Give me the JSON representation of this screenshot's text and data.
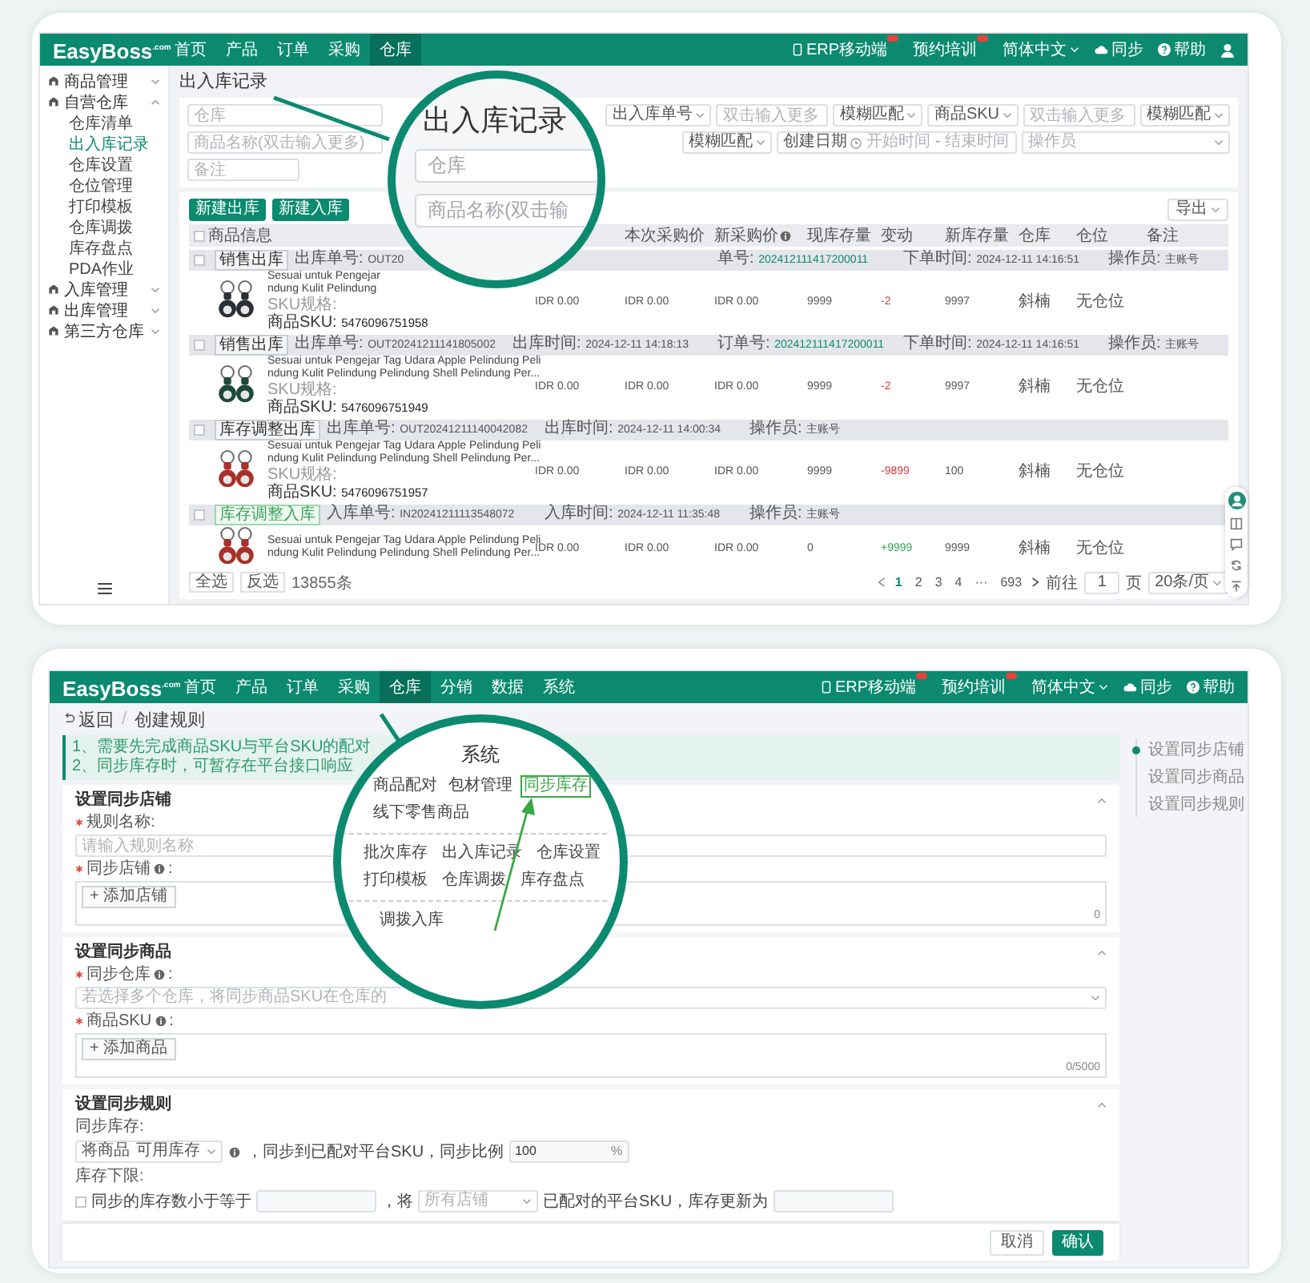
{
  "top_screen": {
    "header": {
      "logo": "EasyBoss",
      "logo_mark": ".com",
      "nav": [
        {
          "label": "首页",
          "selected": false
        },
        {
          "label": "产品",
          "selected": false
        },
        {
          "label": "订单",
          "selected": false
        },
        {
          "label": "采购",
          "selected": false
        },
        {
          "label": "仓库",
          "selected": true
        }
      ],
      "tools": [
        {
          "kind": "mobile",
          "label": "ERP移动端",
          "badge": true
        },
        {
          "kind": "training",
          "label": "预约培训",
          "badge": true
        },
        {
          "kind": "language",
          "label": "简体中文"
        },
        {
          "kind": "sync",
          "label": "同步"
        },
        {
          "kind": "help",
          "label": "帮助"
        },
        {
          "kind": "user"
        }
      ]
    },
    "sidebar": {
      "items": [
        {
          "label": "商品管理",
          "expanded": false
        },
        {
          "label": "自营仓库",
          "expanded": true,
          "children": [
            {
              "label": "仓库清单",
              "selected": false
            },
            {
              "label": "出入库记录",
              "selected": true
            },
            {
              "label": "仓库设置",
              "selected": false
            },
            {
              "label": "仓位管理",
              "selected": false
            },
            {
              "label": "打印模板",
              "selected": false
            },
            {
              "label": "仓库调拨",
              "selected": false
            },
            {
              "label": "库存盘点",
              "selected": false
            },
            {
              "label": "PDA作业",
              "selected": false
            }
          ]
        },
        {
          "label": "入库管理",
          "expanded": false
        },
        {
          "label": "出库管理",
          "expanded": false
        },
        {
          "label": "第三方仓库",
          "expanded": false
        }
      ]
    },
    "page_title": "出入库记录",
    "filters": [
      [
        {
          "kind": "field",
          "placeholder": "仓库"
        },
        {
          "kind": "select",
          "value": "出入库单号"
        },
        {
          "kind": "field",
          "placeholder": "双击输入更多"
        },
        {
          "kind": "select",
          "value": "模糊匹配"
        },
        {
          "kind": "select",
          "value": "商品SKU"
        },
        {
          "kind": "field",
          "placeholder": "双击输入更多"
        },
        {
          "kind": "select",
          "value": "模糊匹配"
        }
      ],
      [
        {
          "kind": "field",
          "placeholder": "商品名称(双击输入更多)"
        },
        {
          "kind": "select",
          "value": "模糊匹配"
        },
        {
          "kind": "date_range",
          "label": "创建日期",
          "start": "开始时间",
          "separator": "-",
          "end": "结束时间"
        },
        {
          "kind": "select",
          "placeholder": "操作员"
        }
      ],
      [
        {
          "kind": "field",
          "placeholder": "备注"
        }
      ]
    ],
    "actions": [
      "新建出库",
      "新建入库"
    ],
    "export": "导出",
    "table": {
      "header_checked": false,
      "columns": [
        {
          "label": "商品信息",
          "kind": "product"
        },
        {
          "label": "本次采购价"
        },
        {
          "label": "新采购价",
          "info": true
        },
        {
          "label": "现库存量"
        },
        {
          "label": "变动"
        },
        {
          "label": "新库存量"
        },
        {
          "label": "仓库"
        },
        {
          "label": "仓位"
        },
        {
          "label": "备注"
        }
      ],
      "records": [
        {
          "tag": "销售出库",
          "inbound": false,
          "checked": false,
          "fields": [
            {
              "kind": "number",
              "label": "出库单号: ",
              "value": "OUT20"
            },
            {
              "kind": "order",
              "label": "单号: ",
              "value": "202412111417200011"
            },
            {
              "kind": "time",
              "label": "下单时间: ",
              "value": "2024-12-11 14:16:51"
            },
            {
              "kind": "operator",
              "label": "操作员: ",
              "value": "主账号"
            }
          ],
          "product": {
            "name_lines": [
              "Sesuai untuk Pengejar",
              "ndung Kulit Pelindung"
            ],
            "spec_label": "SKU规格:",
            "sku_label": "商品SKU: ",
            "sku": "5476096751958"
          },
          "values": [
            "IDR 0.00",
            "IDR 0.00",
            "IDR 0.00",
            "9999"
          ],
          "change": {
            "text": "-2",
            "increase": false
          },
          "new_stock": "9997",
          "warehouse": "斜楠",
          "location": "无仓位"
        },
        {
          "tag": "销售出库",
          "inbound": false,
          "checked": false,
          "fields": [
            {
              "kind": "number",
              "label": "出库单号: ",
              "value": "OUT20241211141805002"
            },
            {
              "kind": "time",
              "label": "出库时间: ",
              "value": "2024-12-11 14:18:13"
            },
            {
              "kind": "order",
              "label": "订单号: ",
              "value": "202412111417200011"
            },
            {
              "kind": "time",
              "label": "下单时间: ",
              "value": "2024-12-11 14:16:51"
            },
            {
              "kind": "operator",
              "label": "操作员: ",
              "value": "主账号"
            }
          ],
          "product": {
            "name_lines": [
              "Sesuai untuk Pengejar Tag Udara Apple Pelindung Peli",
              "ndung Kulit Pelindung Pelindung Shell Pelindung Per..."
            ],
            "spec_label": "SKU规格:",
            "sku_label": "商品SKU: ",
            "sku": "5476096751949"
          },
          "values": [
            "IDR 0.00",
            "IDR 0.00",
            "IDR 0.00",
            "9999"
          ],
          "change": {
            "text": "-2",
            "increase": false
          },
          "new_stock": "9997",
          "warehouse": "斜楠",
          "location": "无仓位"
        },
        {
          "tag": "库存调整出库",
          "inbound": false,
          "checked": false,
          "fields": [
            {
              "kind": "number",
              "label": "出库单号: ",
              "value": "OUT20241211140042082"
            },
            {
              "kind": "time",
              "label": "出库时间: ",
              "value": "2024-12-11 14:00:34"
            },
            {
              "kind": "operator",
              "label": "操作员: ",
              "value": "主账号"
            }
          ],
          "product": {
            "name_lines": [
              "Sesuai untuk Pengejar Tag Udara Apple Pelindung Peli",
              "ndung Kulit Pelindung Pelindung Shell Pelindung Per..."
            ],
            "spec_label": "SKU规格:",
            "sku_label": "商品SKU: ",
            "sku": "5476096751957"
          },
          "values": [
            "IDR 0.00",
            "IDR 0.00",
            "IDR 0.00",
            "9999"
          ],
          "change": {
            "text": "-9899",
            "increase": false
          },
          "new_stock": "100",
          "warehouse": "斜楠",
          "location": "无仓位"
        },
        {
          "tag": "库存调整入库",
          "inbound": true,
          "checked": false,
          "fields": [
            {
              "kind": "number",
              "label": "入库单号: ",
              "value": "IN20241211113548072"
            },
            {
              "kind": "time",
              "label": "入库时间: ",
              "value": "2024-12-11 11:35:48"
            },
            {
              "kind": "operator",
              "label": "操作员: ",
              "value": "主账号"
            }
          ],
          "product": {
            "name_lines": [
              "Sesuai untuk Pengejar Tag Udara Apple Pelindung Peli",
              "ndung Kulit Pelindung Pelindung Shell Pelindung Per..."
            ]
          },
          "values": [
            "IDR 0.00",
            "IDR 0.00",
            "IDR 0.00",
            "0"
          ],
          "change": {
            "text": "+9999",
            "increase": true
          },
          "new_stock": "9999",
          "warehouse": "斜楠",
          "location": "无仓位"
        }
      ]
    },
    "footer": {
      "buttons": [
        "全选",
        "反选"
      ],
      "total": "13855条",
      "pages": [
        {
          "label": "1",
          "selected": true
        },
        {
          "label": "2",
          "selected": false
        },
        {
          "label": "3",
          "selected": false
        },
        {
          "label": "4",
          "selected": false
        },
        {
          "label": "···",
          "selected": false
        },
        {
          "label": "693",
          "selected": false
        }
      ],
      "goto_label": "前往",
      "goto_value": "1",
      "page_unit": "页",
      "page_size": "20条/页"
    },
    "magnifier": {
      "title": "出入库记录",
      "fields": [
        "仓库",
        "商品名称(双击输"
      ]
    }
  },
  "bottom_screen": {
    "header": {
      "logo": "EasyBoss",
      "logo_mark": ".com",
      "nav": [
        {
          "label": "首页",
          "selected": false
        },
        {
          "label": "产品",
          "selected": false
        },
        {
          "label": "订单",
          "selected": false
        },
        {
          "label": "采购",
          "selected": false
        },
        {
          "label": "仓库",
          "selected": true
        },
        {
          "label": "分销",
          "selected": false
        },
        {
          "label": "数据",
          "selected": false
        },
        {
          "label": "系统",
          "selected": false
        }
      ],
      "tools": [
        {
          "kind": "mobile",
          "label": "ERP移动端",
          "badge": true
        },
        {
          "kind": "training",
          "label": "预约培训",
          "badge": true
        },
        {
          "kind": "language",
          "label": "简体中文"
        },
        {
          "kind": "sync",
          "label": "同步"
        },
        {
          "kind": "help",
          "label": "帮助"
        }
      ]
    },
    "breadcrumb": {
      "back": "返回",
      "separator": "/",
      "current": "创建规则"
    },
    "notice": [
      "1、需要先完成商品SKU与平台SKU的配对",
      "2、同步库存时，可暂存在平台接口响应"
    ],
    "sections": [
      {
        "title": "设置同步店铺",
        "expanded": true,
        "fields": [
          {
            "kind": "input",
            "required": true,
            "label": "规则名称:",
            "placeholder": "请输入规则名称"
          },
          {
            "kind": "picker",
            "required": true,
            "label": "同步店铺",
            "info": true,
            "suffix": ":",
            "button": "+ 添加店铺",
            "counter": "0"
          }
        ]
      },
      {
        "title": "设置同步商品",
        "expanded": true,
        "fields": [
          {
            "kind": "select",
            "required": true,
            "label": "同步仓库",
            "info": true,
            "suffix": ":",
            "placeholder": "若选择多个仓库，将同步商品SKU在仓库的"
          },
          {
            "kind": "picker",
            "required": true,
            "label": "商品SKU",
            "info": true,
            "suffix": ":",
            "button": "+ 添加商品",
            "counter": "0/5000"
          }
        ]
      },
      {
        "title": "设置同步规则",
        "expanded": true,
        "fields": [
          {
            "kind": "caption",
            "label": "同步库存:"
          },
          {
            "kind": "row",
            "parts": [
              {
                "kind": "select",
                "prefix": "将商品",
                "value": "可用库存"
              },
              {
                "kind": "info"
              },
              {
                "kind": "text",
                "text": "，同步到已配对平台SKU，同步比例"
              },
              {
                "kind": "input",
                "value": "100",
                "suffix": "%"
              }
            ]
          },
          {
            "kind": "caption",
            "label": "库存下限:"
          },
          {
            "kind": "row",
            "parts": [
              {
                "kind": "checkbox",
                "label": "同步的库存数小于等于",
                "checked": false
              },
              {
                "kind": "input"
              },
              {
                "kind": "text",
                "text": "，将"
              },
              {
                "kind": "select",
                "placeholder": "所有店铺"
              },
              {
                "kind": "text",
                "text": "已配对的平台SKU，库存更新为"
              },
              {
                "kind": "input"
              }
            ]
          }
        ]
      }
    ],
    "anchors": [
      {
        "label": "设置同步店铺",
        "selected": true
      },
      {
        "label": "设置同步商品",
        "selected": false
      },
      {
        "label": "设置同步规则",
        "selected": false
      }
    ],
    "buttons": [
      {
        "label": "取消",
        "kind": "secondary"
      },
      {
        "label": "确认",
        "kind": "primary"
      }
    ],
    "magnifier": {
      "header": "系统",
      "groups": [
        {
          "items": [
            {
              "label": "商品配对",
              "selected": false
            },
            {
              "label": "包材管理",
              "selected": false
            },
            {
              "label": "同步库存",
              "selected": true
            },
            {
              "label": "线下零售商品",
              "selected": false
            }
          ]
        },
        {
          "items": [
            {
              "label": "批次库存",
              "selected": false
            },
            {
              "label": "出入库记录",
              "selected": false
            },
            {
              "label": "仓库设置",
              "selected": false
            },
            {
              "label": "打印模板",
              "selected": false
            },
            {
              "label": "仓库调拨",
              "selected": false
            },
            {
              "label": "库存盘点",
              "selected": false
            }
          ]
        },
        {
          "items": [
            {
              "label": "调拨入库",
              "selected": false
            }
          ]
        }
      ]
    }
  }
}
